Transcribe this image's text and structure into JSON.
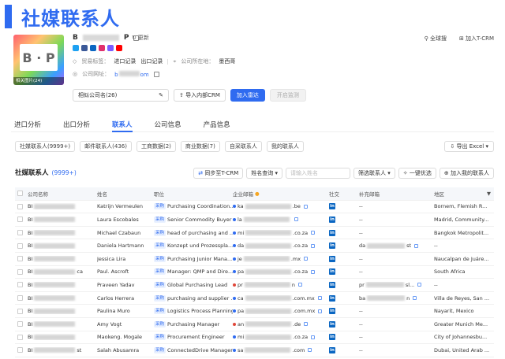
{
  "page": {
    "title": "社媒联系人"
  },
  "company": {
    "logo_caption": "相关图片(24)",
    "name_prefix": "B",
    "name_suffix": "P",
    "update_label": "更新",
    "trade_label": "贸易标签：",
    "import_record": "进口记录",
    "export_record": "出口记录",
    "location_label": "公司所在地：",
    "location_value": "墨西哥",
    "website_label": "公司网址：",
    "website_prefix": "b",
    "website_suffix": "om"
  },
  "top_actions": {
    "global_search": "全球搜",
    "add_crm": "加入T-CRM"
  },
  "filters": {
    "similar_company": "相似公司名(26)",
    "import_crm": "导入内部CRM",
    "add_radar": "加入雷达",
    "enable_monitor": "开启监测"
  },
  "tabs": [
    "进口分析",
    "出口分析",
    "联系人",
    "公司信息",
    "产品信息"
  ],
  "active_tab": 2,
  "subtabs": [
    "社媒联系人(9999+)",
    "邮件联系人(436)",
    "工商数据(2)",
    "商业数据(7)",
    "自采联系人",
    "我的联系人"
  ],
  "export_label": "导出 Excel",
  "list": {
    "title": "社媒联系人",
    "count": "(9999+)",
    "sync_label": "同步至T-CRM",
    "name_query": "姓名查询",
    "search_placeholder": "请输入姓名",
    "filter_label": "筛选联系人",
    "one_click": "一键优选",
    "add_my": "加入我的联系人"
  },
  "columns": [
    "公司名称",
    "姓名",
    "职位",
    "企业邮箱",
    "社交",
    "补充邮箱",
    "地区"
  ],
  "tag_label": "采购",
  "social_icon": "in",
  "rows": [
    {
      "company": "BI",
      "company_tail": "",
      "name": "Katrijn Vermeulen",
      "position": "Purchasing Coordination...",
      "email_prefix": "ka",
      "email_suffix": ".be",
      "dot": "#2f6bf0",
      "extra_prefix": "",
      "extra_suffix": "",
      "region": "Bornem, Flemish R..."
    },
    {
      "company": "BI",
      "company_tail": "",
      "name": "Laura Escobales",
      "position": "Senior Commodity Buyer",
      "email_prefix": "la",
      "email_suffix": "",
      "dot": "#2f6bf0",
      "extra_prefix": "",
      "extra_suffix": "",
      "region": "Madrid, Community..."
    },
    {
      "company": "BI",
      "company_tail": "",
      "name": "Michael Czabaun",
      "position": "head of purchasing and ...",
      "email_prefix": "mi",
      "email_suffix": ".co.za",
      "dot": "#2f6bf0",
      "extra_prefix": "",
      "extra_suffix": "",
      "region": "Bangkok Metropolit..."
    },
    {
      "company": "BI",
      "company_tail": "",
      "name": "Daniela Hartmann",
      "position": "Konzept und Prozessplа...",
      "email_prefix": "da",
      "email_suffix": ".co.za",
      "dot": "#2f6bf0",
      "extra_prefix": "da",
      "extra_suffix": "st",
      "region": "--"
    },
    {
      "company": "BI",
      "company_tail": "",
      "name": "Jessica Lira",
      "position": "Purchasing Junior Mana...",
      "email_prefix": "je",
      "email_suffix": ".mx",
      "dot": "#2f6bf0",
      "extra_prefix": "",
      "extra_suffix": "",
      "region": "Naucalpan de Juáre..."
    },
    {
      "company": "BI",
      "company_tail": "ca",
      "name": "Paul. Ascroft",
      "position": "Manager: QMP and Dire...",
      "email_prefix": "pa",
      "email_suffix": ".co.za",
      "dot": "#2f6bf0",
      "extra_prefix": "",
      "extra_suffix": "",
      "region": "South Africa"
    },
    {
      "company": "BI",
      "company_tail": "",
      "name": "Praveen Yadav",
      "position": "Global Purchasing Lead",
      "email_prefix": "pr",
      "email_suffix": "n",
      "dot": "#e0473a",
      "extra_prefix": "pr",
      "extra_suffix": "sl...",
      "region": "--"
    },
    {
      "company": "BI",
      "company_tail": "",
      "name": "Carlos Herrera",
      "position": "purchasing and supplier ...",
      "email_prefix": "ca",
      "email_suffix": ".com.mx",
      "dot": "#2f6bf0",
      "extra_prefix": "ba",
      "extra_suffix": "n",
      "region": "Villa de Reyes, San ..."
    },
    {
      "company": "BI",
      "company_tail": "",
      "name": "Paulina Muro",
      "position": "Logistics Process Planning",
      "email_prefix": "pa",
      "email_suffix": ".com.mx",
      "dot": "#2f6bf0",
      "extra_prefix": "",
      "extra_suffix": "",
      "region": "Nayarit, Mexico"
    },
    {
      "company": "BI",
      "company_tail": "",
      "name": "Amy Vogt",
      "position": "Purchasing Manager",
      "email_prefix": "an",
      "email_suffix": ".de",
      "dot": "#e0473a",
      "extra_prefix": "",
      "extra_suffix": "",
      "region": "Greater Munich Me..."
    },
    {
      "company": "BI",
      "company_tail": "",
      "name": "Maokeng. Mogale",
      "position": "Procurement Engineer",
      "email_prefix": "mi",
      "email_suffix": ".co.za",
      "dot": "#2f6bf0",
      "extra_prefix": "",
      "extra_suffix": "",
      "region": "City of Johannesbu..."
    },
    {
      "company": "BI",
      "company_tail": "st",
      "name": "Salah Abusamra",
      "position": "ConnectedDrive Manager",
      "email_prefix": "sa",
      "email_suffix": ".com",
      "dot": "#2f6bf0",
      "extra_prefix": "",
      "extra_suffix": "",
      "region": "Dubai, United Arab ..."
    }
  ],
  "colors": {
    "accent": "#2f6bf0",
    "linkedin": "#0a66c2"
  }
}
